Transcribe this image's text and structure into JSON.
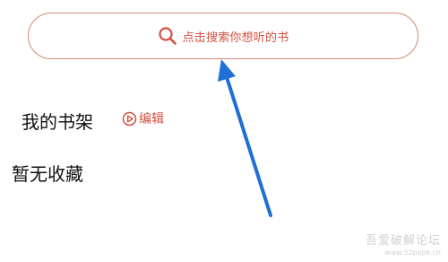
{
  "search": {
    "placeholder": "点击搜索你想听的书",
    "icon": "search-icon",
    "accent_color": "#d24f3e",
    "border_color": "#d8887a"
  },
  "shelf": {
    "title": "我的书架",
    "edit_label": "编辑",
    "edit_icon": "play-circle-icon"
  },
  "favorites": {
    "empty_text": "暂无收藏"
  },
  "annotation": {
    "arrow_color": "#1f6fd6"
  },
  "watermark": {
    "text": "吾爱破解论坛",
    "url": "www.52pojie.cn"
  }
}
